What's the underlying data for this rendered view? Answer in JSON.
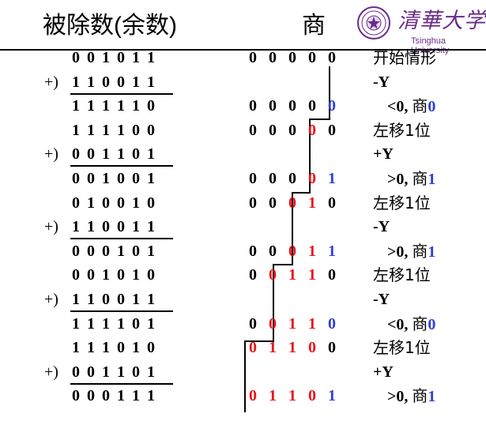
{
  "header": {
    "dividend_label": "被除数(余数)",
    "quotient_label": "商",
    "logo_text": "清華大学",
    "logo_subtext": "Tsinghua University",
    "colors": {
      "red": "#e8141c",
      "blue": "#2f3fd6",
      "logo": "#6a2c8a"
    }
  },
  "rows": [
    {
      "sign": "",
      "bits": "001011",
      "underline": false,
      "quotient": [
        [
          "0",
          "k"
        ],
        [
          "0",
          "k"
        ],
        [
          "0",
          "k"
        ],
        [
          "0",
          "k"
        ],
        [
          "0",
          "k"
        ]
      ],
      "note": [
        {
          "t": "开始情形",
          "c": "k",
          "cn": true
        }
      ]
    },
    {
      "sign": "+)",
      "bits": "110011",
      "underline": true,
      "quotient": [],
      "note": [
        {
          "t": "-Y",
          "c": "k",
          "cn": false
        }
      ]
    },
    {
      "sign": "",
      "bits": "111110",
      "underline": false,
      "quotient": [
        [
          "0",
          "k"
        ],
        [
          "0",
          "k"
        ],
        [
          "0",
          "k"
        ],
        [
          "0",
          "k"
        ],
        [
          "0",
          "b"
        ]
      ],
      "note": [
        {
          "t": "<0, ",
          "c": "k",
          "cn": false
        },
        {
          "t": "商",
          "c": "k",
          "cn": true
        },
        {
          "t": "0",
          "c": "b",
          "cn": false
        }
      ]
    },
    {
      "sign": "",
      "bits": "111100",
      "underline": false,
      "quotient": [
        [
          "0",
          "k"
        ],
        [
          "0",
          "k"
        ],
        [
          "0",
          "k"
        ],
        [
          "0",
          "r"
        ],
        [
          "0",
          "k"
        ]
      ],
      "note": [
        {
          "t": "左移1位",
          "c": "k",
          "cn": true
        }
      ]
    },
    {
      "sign": "+)",
      "bits": "001101",
      "underline": true,
      "quotient": [],
      "note": [
        {
          "t": "+Y",
          "c": "k",
          "cn": false
        }
      ]
    },
    {
      "sign": "",
      "bits": "001001",
      "underline": false,
      "quotient": [
        [
          "0",
          "k"
        ],
        [
          "0",
          "k"
        ],
        [
          "0",
          "k"
        ],
        [
          "0",
          "r"
        ],
        [
          "1",
          "b"
        ]
      ],
      "note": [
        {
          "t": ">0, ",
          "c": "k",
          "cn": false
        },
        {
          "t": "商",
          "c": "k",
          "cn": true
        },
        {
          "t": "1",
          "c": "b",
          "cn": false
        }
      ]
    },
    {
      "sign": "",
      "bits": "010010",
      "underline": false,
      "quotient": [
        [
          "0",
          "k"
        ],
        [
          "0",
          "k"
        ],
        [
          "0",
          "r"
        ],
        [
          "1",
          "r"
        ],
        [
          "0",
          "k"
        ]
      ],
      "note": [
        {
          "t": "左移1位",
          "c": "k",
          "cn": true
        }
      ]
    },
    {
      "sign": "+)",
      "bits": "110011",
      "underline": true,
      "quotient": [],
      "note": [
        {
          "t": "-Y",
          "c": "k",
          "cn": false
        }
      ]
    },
    {
      "sign": "",
      "bits": "000101",
      "underline": false,
      "quotient": [
        [
          "0",
          "k"
        ],
        [
          "0",
          "k"
        ],
        [
          "0",
          "r"
        ],
        [
          "1",
          "r"
        ],
        [
          "1",
          "b"
        ]
      ],
      "note": [
        {
          "t": ">0, ",
          "c": "k",
          "cn": false
        },
        {
          "t": "商",
          "c": "k",
          "cn": true
        },
        {
          "t": "1",
          "c": "b",
          "cn": false
        }
      ]
    },
    {
      "sign": "",
      "bits": "001010",
      "underline": false,
      "quotient": [
        [
          "0",
          "k"
        ],
        [
          "0",
          "r"
        ],
        [
          "1",
          "r"
        ],
        [
          "1",
          "r"
        ],
        [
          "0",
          "k"
        ]
      ],
      "note": [
        {
          "t": "左移1位",
          "c": "k",
          "cn": true
        }
      ]
    },
    {
      "sign": "+)",
      "bits": "110011",
      "underline": true,
      "quotient": [],
      "note": [
        {
          "t": "-Y",
          "c": "k",
          "cn": false
        }
      ]
    },
    {
      "sign": "",
      "bits": "111101",
      "underline": false,
      "quotient": [
        [
          "0",
          "k"
        ],
        [
          "0",
          "r"
        ],
        [
          "1",
          "r"
        ],
        [
          "1",
          "r"
        ],
        [
          "0",
          "b"
        ]
      ],
      "note": [
        {
          "t": "<0, ",
          "c": "k",
          "cn": false
        },
        {
          "t": "商",
          "c": "k",
          "cn": true
        },
        {
          "t": "0",
          "c": "b",
          "cn": false
        }
      ]
    },
    {
      "sign": "",
      "bits": "111010",
      "underline": false,
      "quotient": [
        [
          "0",
          "r"
        ],
        [
          "1",
          "r"
        ],
        [
          "1",
          "r"
        ],
        [
          "0",
          "r"
        ],
        [
          "0",
          "k"
        ]
      ],
      "note": [
        {
          "t": "左移1位",
          "c": "k",
          "cn": true
        }
      ]
    },
    {
      "sign": "+)",
      "bits": "001101",
      "underline": true,
      "quotient": [],
      "note": [
        {
          "t": "+Y",
          "c": "k",
          "cn": false
        }
      ]
    },
    {
      "sign": "",
      "bits": "000111",
      "underline": false,
      "quotient": [
        [
          "0",
          "r"
        ],
        [
          "1",
          "r"
        ],
        [
          "1",
          "r"
        ],
        [
          "0",
          "r"
        ],
        [
          "1",
          "b"
        ]
      ],
      "note": [
        {
          "t": ">0, ",
          "c": "k",
          "cn": false
        },
        {
          "t": "商",
          "c": "k",
          "cn": true
        },
        {
          "t": "1",
          "c": "b",
          "cn": false
        }
      ]
    }
  ]
}
